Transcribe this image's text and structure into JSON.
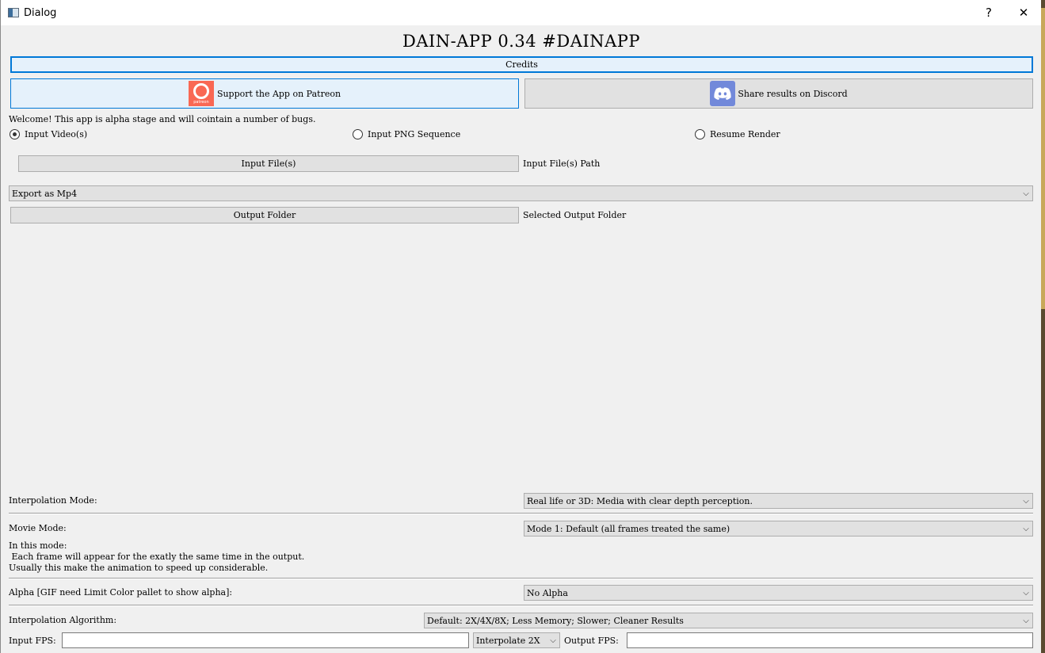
{
  "window": {
    "title": "Dialog",
    "help_button": "?",
    "close_button": "✕"
  },
  "app": {
    "heading": "DAIN-APP 0.34 #DAINAPP",
    "credits_button": "Credits",
    "patreon_button": "Support the App on Patreon",
    "patreon_logo_text": "patreon",
    "discord_button": "Share results on Discord",
    "welcome_text": "Welcome! This app is alpha stage and will cointain a number of bugs."
  },
  "input_mode": {
    "options": [
      {
        "label": "Input Video(s)",
        "selected": true
      },
      {
        "label": "Input PNG Sequence",
        "selected": false
      },
      {
        "label": "Resume Render",
        "selected": false
      }
    ]
  },
  "input_files": {
    "button": "Input File(s)",
    "path_label": "Input File(s) Path"
  },
  "export": {
    "selected": "Export as Mp4"
  },
  "output": {
    "button": "Output Folder",
    "path_label": "Selected Output Folder"
  },
  "interpolation_mode": {
    "label": "Interpolation Mode:",
    "selected": "Real life or 3D: Media with clear depth perception."
  },
  "movie_mode": {
    "label": "Movie Mode:",
    "selected": "Mode 1: Default (all frames treated the same)",
    "description_line1": "In this mode:",
    "description_line2": " Each frame will appear for the exatly the same time in the output.",
    "description_line3": "Usually this make the animation to speed up considerable."
  },
  "alpha": {
    "label": "Alpha [GIF need Limit Color pallet to show alpha]:",
    "selected": "No Alpha"
  },
  "algorithm": {
    "label": "Interpolation Algorithm:",
    "selected": "Default: 2X/4X/8X; Less Memory; Slower; Cleaner Results"
  },
  "fps": {
    "input_label": "Input FPS:",
    "input_value": "",
    "interpolate_selected": "Interpolate 2X",
    "output_label": "Output FPS:",
    "output_value": ""
  },
  "icons": {
    "app": "window-icon",
    "patreon": "patreon-logo-icon",
    "discord": "discord-logo-icon",
    "dropdown": "chevron-down-icon"
  },
  "colors": {
    "window_bg": "#f0f0f0",
    "button_bg": "#e1e1e1",
    "focus_accent": "#0078d7",
    "patreon": "#f96854",
    "discord": "#7289da"
  }
}
